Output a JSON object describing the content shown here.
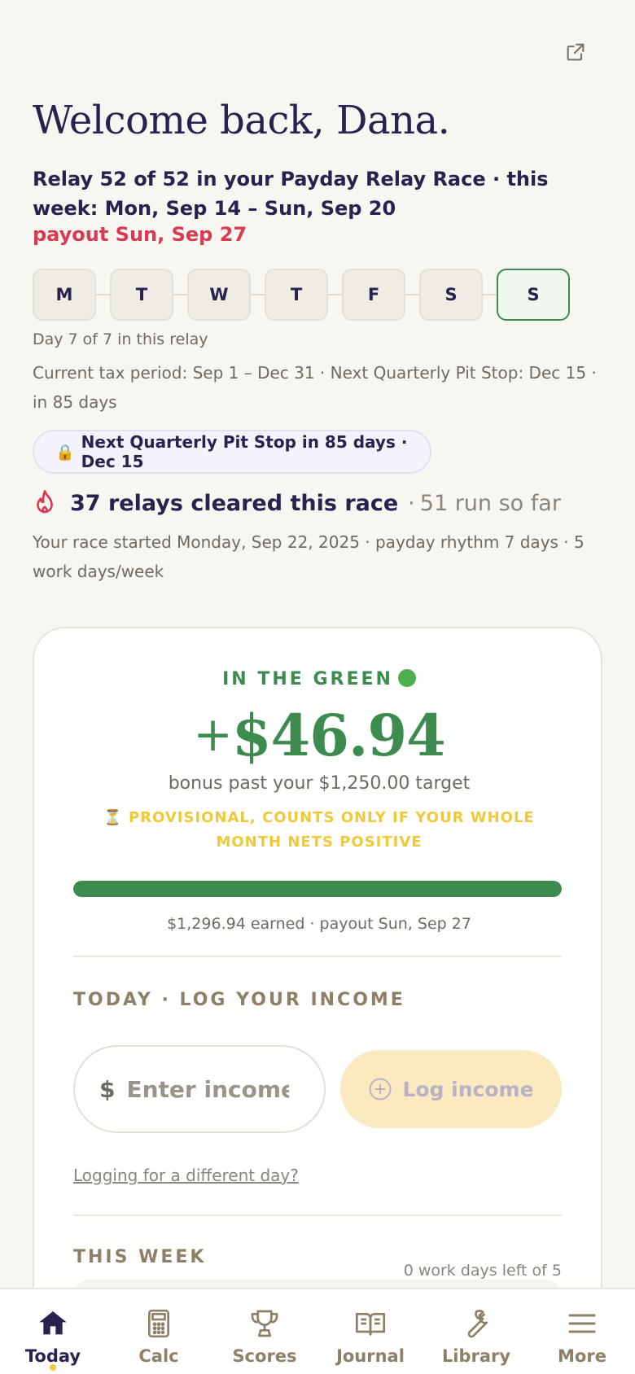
{
  "header": {
    "welcome": "Welcome back, Dana.",
    "relay_line": "Relay 52 of 52 in your Payday Relay Race · this week: Mon, Sep 14 – Sun, Sep 20",
    "payout_line": "payout Sun, Sep 27",
    "external_icon": "external-link-icon"
  },
  "week_days": [
    {
      "label": "M",
      "active": false
    },
    {
      "label": "T",
      "active": false
    },
    {
      "label": "W",
      "active": false
    },
    {
      "label": "T",
      "active": false
    },
    {
      "label": "F",
      "active": false
    },
    {
      "label": "S",
      "active": false
    },
    {
      "label": "S",
      "active": true
    }
  ],
  "relay_status": {
    "day_of": "Day 7 of 7 in this relay",
    "tax_line": "Current tax period: Sep 1 – Dec 31 · Next Quarterly Pit Stop: Dec 15 · in 85 days",
    "pit_badge": "Next Quarterly Pit Stop in 85 days · Dec 15",
    "pit_icon": "lock-icon"
  },
  "streak": {
    "main": "37 relays cleared this race",
    "sub": "51 run so far",
    "separator": "·",
    "icon": "flame-icon"
  },
  "race_line": "Your race started Monday, Sep 22, 2025 · payday rhythm 7 days · 5 work days/week",
  "summary_card": {
    "status_label": "IN THE GREEN",
    "amount_sign": "+",
    "amount": "$46.94",
    "bonus_text": "bonus past your $1,250.00 target",
    "provisional": "⏳ PROVISIONAL, COUNTS ONLY IF YOUR WHOLE MONTH NETS POSITIVE",
    "progress_fraction": 1.0,
    "earned_text": "$1,296.94 earned · payout Sun, Sep 27",
    "colors": {
      "green": "#3e8b4f",
      "gold": "#f0c93a"
    }
  },
  "log_income": {
    "section_label": "TODAY · LOG YOUR INCOME",
    "currency_symbol": "$",
    "input_value": "",
    "input_placeholder": "Enter income",
    "button_label": "Log income",
    "diff_day_link": "Logging for a different day?"
  },
  "this_week": {
    "section_label": "THIS WEEK",
    "days_left": "0 work days left of 5"
  },
  "bottom_nav": [
    {
      "label": "Today",
      "icon": "home-icon",
      "active": true
    },
    {
      "label": "Calc",
      "icon": "calculator-icon",
      "active": false
    },
    {
      "label": "Scores",
      "icon": "trophy-icon",
      "active": false
    },
    {
      "label": "Journal",
      "icon": "book-icon",
      "active": false
    },
    {
      "label": "Library",
      "icon": "wrench-icon",
      "active": false
    },
    {
      "label": "More",
      "icon": "menu-icon",
      "active": false
    }
  ]
}
